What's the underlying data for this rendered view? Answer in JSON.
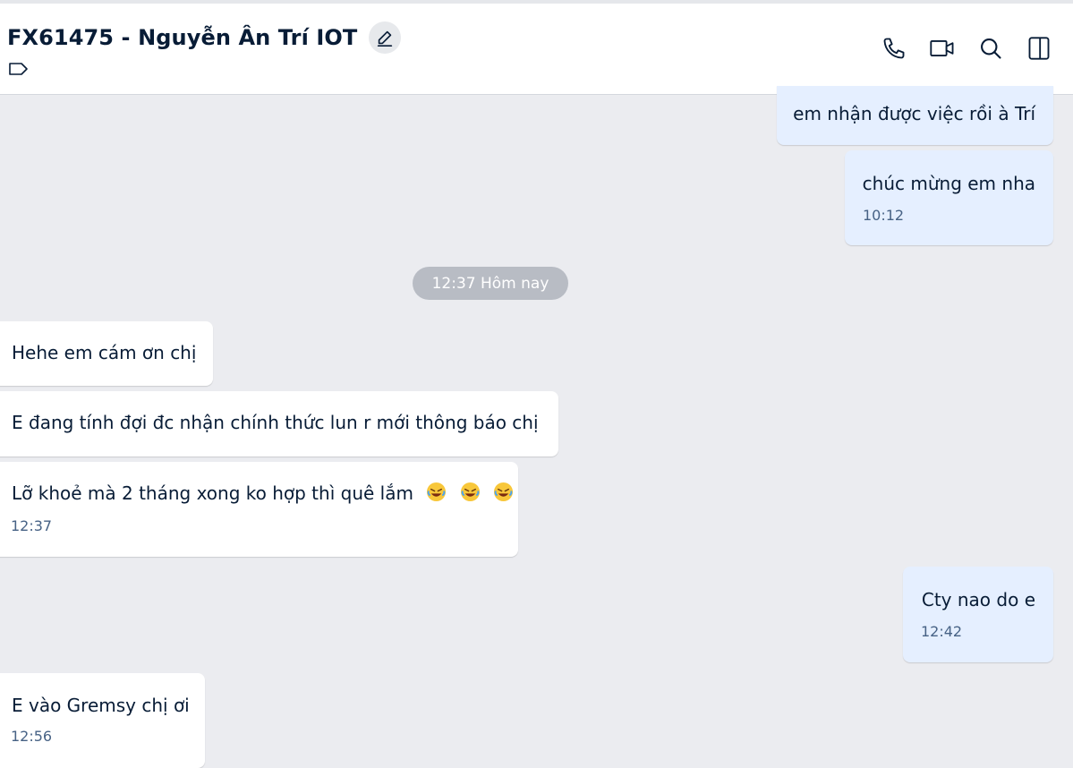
{
  "header": {
    "title": "FX61475 - Nguyễn Ân Trí IOT",
    "icons": {
      "edit": "pencil-icon",
      "tag": "tag-icon",
      "call": "phone-icon",
      "video": "video-call-icon",
      "search": "search-icon",
      "panel": "sidebar-toggle-icon"
    }
  },
  "messages": [
    {
      "text": "em nhận được việc rồi à Trí",
      "direction": "outgoing"
    },
    {
      "text": "chúc mừng em nha",
      "time": "10:12",
      "direction": "outgoing"
    },
    {
      "text": "Hehe em cám ơn chị",
      "direction": "incoming"
    },
    {
      "text": "E đang tính đợi đc nhận chính thức lun r mới thông báo chị",
      "direction": "incoming"
    },
    {
      "text": "Lỡ khoẻ mà 2 tháng xong ko hợp thì quê lắm",
      "time": "12:37",
      "direction": "incoming",
      "emoji": [
        "rolling-on-floor-laughing-emoji",
        "rolling-on-floor-laughing-emoji",
        "rolling-on-floor-laughing-emoji"
      ]
    },
    {
      "text": "Cty nao do e",
      "time": "12:42",
      "direction": "outgoing"
    },
    {
      "text": "E vào Gremsy chị ơi",
      "time": "12:56",
      "direction": "incoming"
    }
  ],
  "divider": {
    "label": "12:37 Hôm nay"
  },
  "colors": {
    "background": "#ebecf0",
    "incoming_bubble": "#ffffff",
    "outgoing_bubble": "#e5efff",
    "divider_pill": "#b8bcc4",
    "text": "#081c36",
    "time_text": "#476285"
  }
}
